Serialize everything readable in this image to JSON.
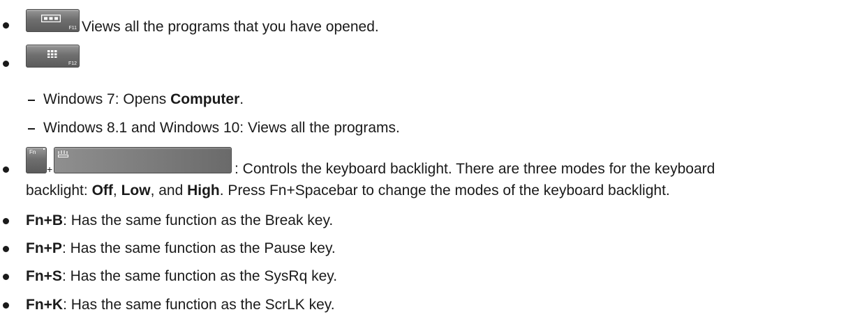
{
  "items": [
    {
      "key": {
        "icon": "windows-overview-icon",
        "sublabel": "F11"
      },
      "text": "Views all the programs that you have opened."
    },
    {
      "key": {
        "icon": "apps-grid-icon",
        "sublabel": "F12"
      },
      "subitems": [
        {
          "prefix": "Windows 7: Opens ",
          "bold": "Computer",
          "suffix": "."
        },
        {
          "text": "Windows 8.1 and Windows 10: Views all the programs."
        }
      ]
    },
    {
      "keys": {
        "fn_label": "Fn",
        "plus": "+",
        "space_icon": "keyboard-backlight-icon"
      },
      "line1": ": Controls the keyboard backlight. There are three modes for the keyboard",
      "line2": {
        "t1": "backlight: ",
        "b1": "Off",
        "t2": ", ",
        "b2": "Low",
        "t3": ", and ",
        "b3": "High",
        "t4": ". Press Fn+Spacebar to change the modes of the keyboard backlight."
      }
    },
    {
      "bold": "Fn+B",
      "text": ": Has the same function as the Break key."
    },
    {
      "bold": "Fn+P",
      "text": ": Has the same function as the Pause key."
    },
    {
      "bold": "Fn+S",
      "text": ": Has the same function as the SysRq key."
    },
    {
      "bold": "Fn+K",
      "text": ": Has the same function as the ScrLK key."
    }
  ]
}
